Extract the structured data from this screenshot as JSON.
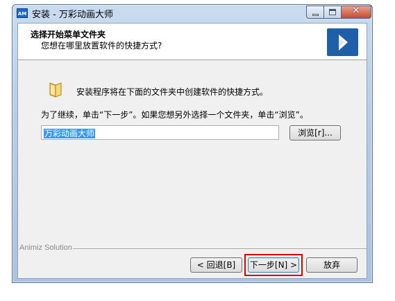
{
  "window": {
    "app_icon_text": "AM",
    "title": "安装 - 万彩动画大师"
  },
  "header": {
    "title": "选择开始菜单文件夹",
    "subtitle": "您想在哪里放置软件的快捷方式?"
  },
  "body": {
    "info": "安装程序将在下面的文件夹中创建软件的快捷方式。",
    "instruction": "为了继续，单击“下一步”。如果您想另外选择一个文件夹，单击“浏览”。",
    "folder_value": "万彩动画大师",
    "browse_label": "浏览[r]..."
  },
  "footer": {
    "brand": "Animiz Solution",
    "back_label": "< 回退[B]",
    "next_label": "下一步[N] >",
    "cancel_label": "放弃"
  },
  "colors": {
    "highlight": "#e00000",
    "selection": "#3399ff",
    "logo": "#1f5fa8"
  }
}
